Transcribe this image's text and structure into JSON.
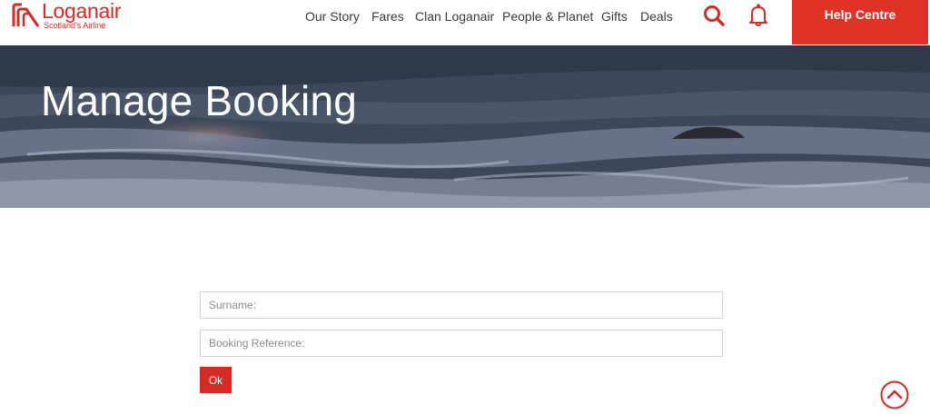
{
  "brand": {
    "name": "Loganair",
    "tagline": "Scotland's Airline",
    "color": "#d42b24"
  },
  "nav": {
    "items": [
      "Our Story",
      "Fares",
      "Clan Loganair",
      "People & Planet",
      "Gifts",
      "Deals"
    ],
    "search_icon": "search-icon",
    "notifications_icon": "bell-icon",
    "help_label": "Help Centre",
    "help_color": "#e03126"
  },
  "hero": {
    "title": "Manage Booking"
  },
  "form": {
    "surname_placeholder": "Surname:",
    "surname_value": "",
    "reference_placeholder": "Booking Reference:",
    "reference_value": "",
    "submit_label": "Ok"
  },
  "scroll_top_icon": "chevron-up-circle-icon"
}
